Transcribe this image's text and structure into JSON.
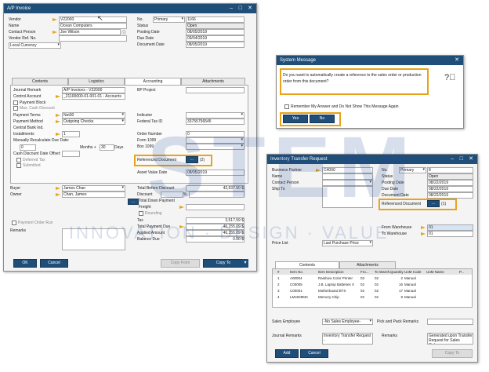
{
  "ap_invoice": {
    "title": "A/P Invoice",
    "labels": {
      "vendor": "Vendor",
      "name": "Name",
      "contact_person": "Contact Person",
      "vendor_ref": "Vendor Ref. No.",
      "currency": "Local Currency",
      "no": "No.",
      "status": "Status",
      "posting_date": "Posting Date",
      "due_date": "Due Date",
      "document_date": "Document Date"
    },
    "values": {
      "vendor": "V22000",
      "name": "Ocean Computers",
      "contact_person": "Joe Wilson",
      "vendor_ref": "",
      "series": "Primary",
      "number": "1166",
      "status": "Open",
      "posting_date": "08/05/2019",
      "due_date": "09/04/2019",
      "document_date": "08/05/2019"
    },
    "tabs": [
      "Contents",
      "Logistics",
      "Accounting",
      "Attachments"
    ],
    "accounting": {
      "journal_remark_label": "Journal Remark",
      "journal_remark": "A/P Invoices - V22000",
      "control_account_label": "Control Account",
      "control_account": "_21100000-01-001-01 - Accounts",
      "payment_block": "Payment Block",
      "max_cash_discount": "Max. Cash Discount",
      "payment_terms_label": "Payment Terms",
      "payment_terms": "Net30",
      "payment_method_label": "Payment Method",
      "payment_method": "Outgoing Checks",
      "central_bank_label": "Central Bank Ind.",
      "installments_label": "Installments",
      "installments": "1",
      "manually_recalculate": "Manually Recalculate Due Date:",
      "months_value": "0",
      "months_label": "Months +",
      "days_value": "30",
      "days_label": "Days",
      "cash_discount_offset": "Cash Discount Date Offset:",
      "deferred_tax": "Deferred Tax",
      "submitted": "Submitted",
      "bp_project_label": "BP Project",
      "indicator_label": "Indicator",
      "federal_tax_label": "Federal Tax ID",
      "federal_tax": "33755756545",
      "order_number_label": "Order Number",
      "order_number": "0",
      "form_label": "Form 1099",
      "box_label": "Box 1099",
      "ref_doc_label": "Referenced Document",
      "ref_doc_btn": "...",
      "ref_doc_count": "(2)",
      "asset_value_label": "Asset Value Date",
      "asset_value": "08/05/2019"
    },
    "footer": {
      "buyer_label": "Buyer",
      "buyer": "James Chan",
      "owner_label": "Owner",
      "owner": "Chan, James",
      "payment_order_run": "Payment Order Run",
      "remarks_label": "Remarks",
      "total_before_discount_label": "Total Before Discount",
      "total_before_discount": "42,637.50 $",
      "discount_label": "Discount",
      "discount_pct": "%",
      "total_down_payment_label": "Total Down Payment",
      "freight_label": "Freight",
      "rounding_label": "Rounding",
      "tax_label": "Tax",
      "tax": "3,517.59 $",
      "total_payment_due_label": "Total Payment Due",
      "total_payment_due": "46,155.09 $",
      "applied_amount_label": "Applied Amount",
      "applied_amount": "46,155.09 $",
      "balance_due_label": "Balance Due",
      "balance_due": "0.00 $"
    },
    "buttons": {
      "ok": "OK",
      "cancel": "Cancel",
      "copy_from": "Copy From",
      "copy_to": "Copy To"
    }
  },
  "system_message": {
    "title": "System Message",
    "message": "Do you want to automatically create a reference to the sales order or production order from this document?",
    "remember": "Remember My Answer and Do Not Show This Message Again",
    "yes": "Yes",
    "no": "No"
  },
  "inventory_transfer": {
    "title": "Inventory Transfer Request",
    "labels": {
      "business_partner": "Business Partner",
      "name": "Name",
      "contact_person": "Contact Person",
      "ship_to": "Ship To",
      "no": "No.",
      "status": "Status",
      "posting_date": "Posting Date",
      "due_date": "Due Date",
      "document_date": "Document Date",
      "ref_doc": "Referenced Document",
      "from_warehouse": "From Warehouse",
      "to_warehouse": "To Warehouse",
      "price_list": "Price List"
    },
    "values": {
      "business_partner": "C4000",
      "series": "Primary",
      "number": "8",
      "status": "Open",
      "posting_date": "08/22/2019",
      "due_date": "08/22/2019",
      "document_date": "08/22/2019",
      "ref_doc_btn": "...",
      "ref_doc_count": "(1)",
      "from_warehouse": "01",
      "to_warehouse": "01",
      "price_list": "Last Purchase Price"
    },
    "tabs": [
      "Contents",
      "Attachments"
    ],
    "grid": {
      "headers": [
        "#",
        "Item No.",
        "Item Description",
        "Fro...",
        "To Wareh...",
        "Quantity",
        "UoM Code",
        "UoM Name",
        "P..."
      ],
      "rows": [
        [
          "1",
          "A00004",
          "Rainbow Color Printer",
          "02",
          "02",
          "2",
          "Manual"
        ],
        [
          "2",
          "C00005",
          "J.B. Laptop Batteries X",
          "02",
          "02",
          "16",
          "Manual"
        ],
        [
          "3",
          "C00001",
          "Motherboard BTX",
          "02",
          "02",
          "17",
          "Manual"
        ],
        [
          "4",
          "LM4029MC",
          "Memory Chip",
          "02",
          "02",
          "8",
          "Manual"
        ]
      ]
    },
    "footer": {
      "sales_employee_label": "Sales Employee",
      "sales_employee": "-No Sales Employee-",
      "pick_pack_label": "Pick and Pack Remarks",
      "journal_remarks_label": "Journal Remarks",
      "journal_remarks": "Inventory Transfer Request -",
      "remarks_label": "Remarks",
      "remarks": "Generated upon Transfer Request for Sales Orders",
      "add": "Add",
      "cancel": "Cancel",
      "copy_to": "Copy To"
    }
  },
  "watermark": {
    "brand": "STEM",
    "tagline": "INNOVATION · DESIGN · VALUE"
  },
  "colors": {
    "titlebar": "#1f4e79",
    "highlight": "#e8a317",
    "arrow": "#e8a317"
  }
}
